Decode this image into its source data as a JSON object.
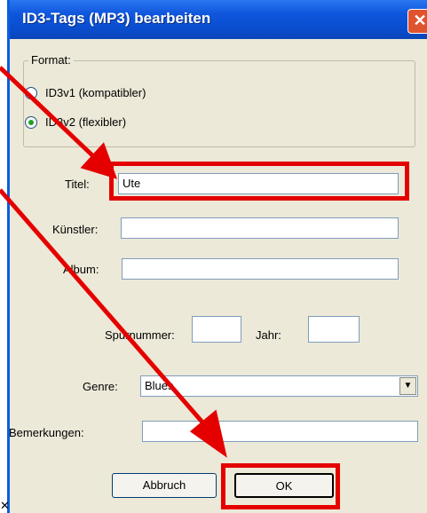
{
  "window": {
    "title": "ID3-Tags (MP3) bearbeiten",
    "close_glyph": "✕"
  },
  "format": {
    "legend": "Format:",
    "options": [
      {
        "label": "ID3v1 (kompatibler)",
        "checked": false
      },
      {
        "label": "ID3v2 (flexibler)",
        "checked": true
      }
    ]
  },
  "fields": {
    "title_label": "Titel:",
    "title_value": "Ute",
    "artist_label": "Künstler:",
    "artist_value": "",
    "album_label": "Album:",
    "album_value": "",
    "track_label": "Spurnummer:",
    "track_value": "",
    "year_label": "Jahr:",
    "year_value": "",
    "genre_label": "Genre:",
    "genre_value": "Blues",
    "comments_label": "Bemerkungen:",
    "comments_value": ""
  },
  "buttons": {
    "cancel": "Abbruch",
    "ok": "OK"
  },
  "annotation_color": "#e50000"
}
